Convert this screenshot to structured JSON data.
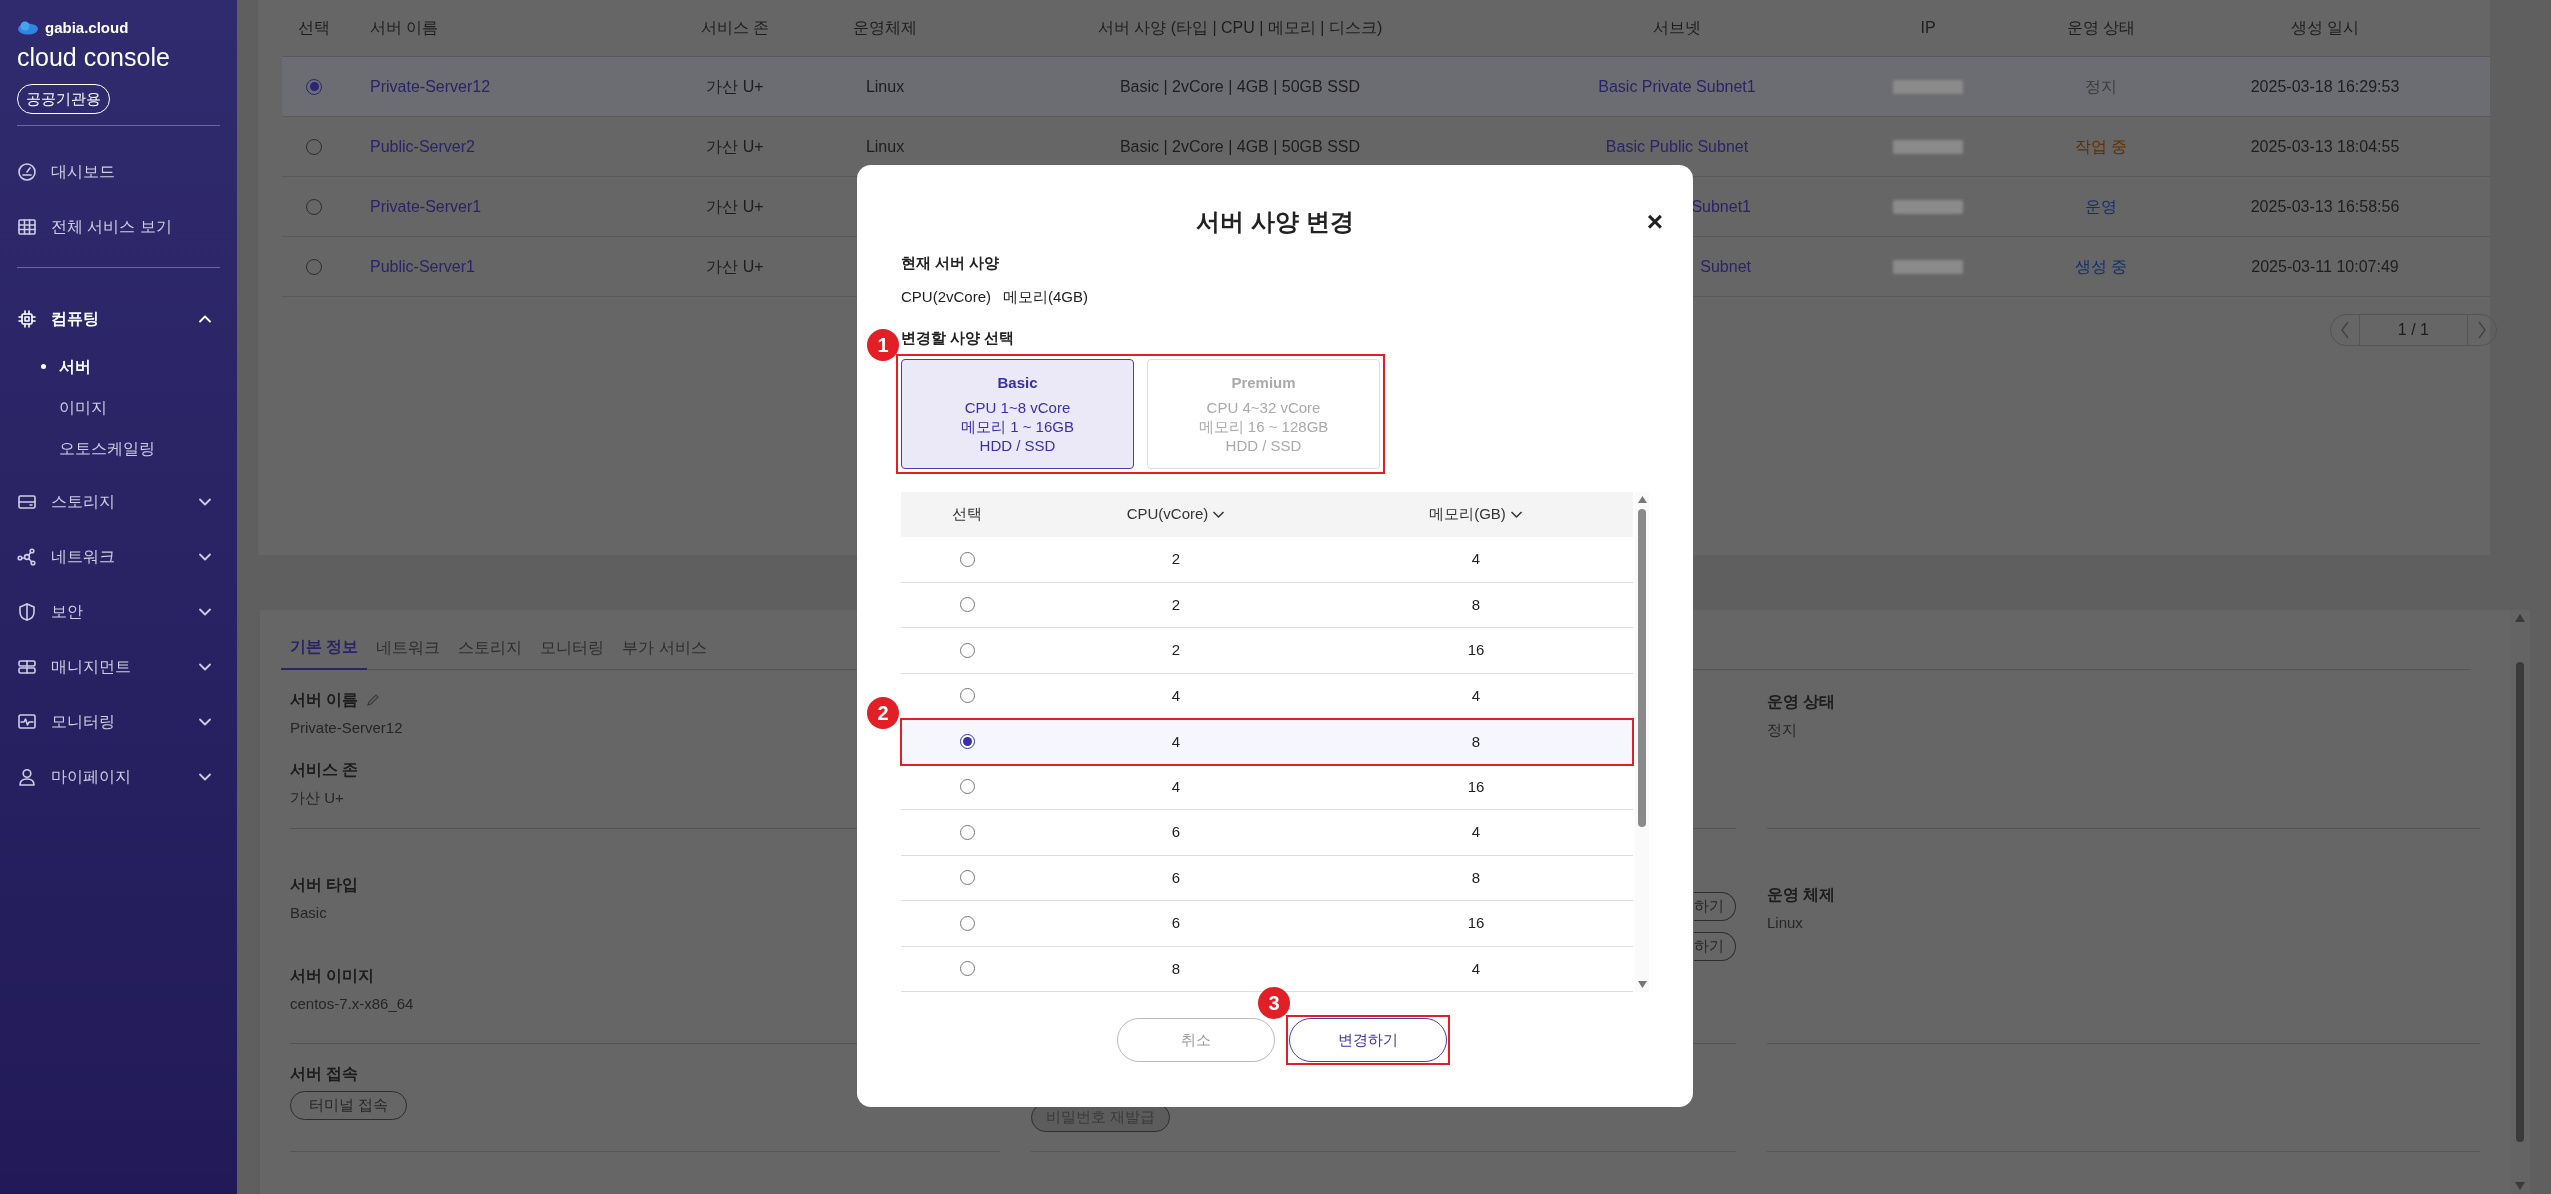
{
  "sidebar": {
    "brand": "gabia.cloud",
    "product": "**cloud** console",
    "badge": "공공기관용",
    "menu": [
      {
        "label": "대시보드"
      },
      {
        "label": "전체 서비스 보기"
      }
    ],
    "groups": [
      {
        "label": "컴퓨팅",
        "expanded": true,
        "children": [
          {
            "label": "서버",
            "selected": true
          },
          {
            "label": "이미지",
            "selected": false
          },
          {
            "label": "오토스케일링",
            "selected": false
          }
        ]
      },
      {
        "label": "스토리지",
        "expanded": false
      },
      {
        "label": "네트워크",
        "expanded": false
      },
      {
        "label": "보안",
        "expanded": false
      },
      {
        "label": "매니지먼트",
        "expanded": false
      },
      {
        "label": "모니터링",
        "expanded": false
      },
      {
        "label": "마이페이지",
        "expanded": false
      }
    ]
  },
  "server_table": {
    "columns": [
      "선택",
      "서버 이름",
      "서비스 존",
      "운영체제",
      "서버 사양 (타입 | CPU | 메모리 | 디스크)",
      "서브넷",
      "IP",
      "운영 상태",
      "생성 일시"
    ],
    "rows": [
      {
        "selected": true,
        "name": "Private-Server12",
        "zone": "가산 U+",
        "os": "Linux",
        "spec": "Basic | 2vCore | 4GB | 50GB SSD",
        "subnet": "Basic Private Subnet1",
        "status": "정지",
        "color": "#3d3d3d",
        "created": "2025-03-18 16:29:53"
      },
      {
        "selected": false,
        "name": "Public-Server2",
        "zone": "가산 U+",
        "os": "Linux",
        "spec": "Basic | 2vCore | 4GB | 50GB SSD",
        "subnet": "Basic Public Subnet",
        "status": "작업 중",
        "color": "#5e3100",
        "created": "2025-03-13 18:04:55"
      },
      {
        "selected": false,
        "name": "Private-Server1",
        "zone": "가산 U+",
        "subnet": "Subnet1",
        "subnet_cut": true,
        "status": "운영",
        "color": "#142f6e",
        "created": "2025-03-13 16:58:56"
      },
      {
        "selected": false,
        "name": "Public-Server1",
        "zone": "가산 U+",
        "subnet": "Subnet",
        "subnet_cut": true,
        "status": "생성 중",
        "color": "#142f6e",
        "created": "2025-03-11 10:07:49"
      }
    ],
    "pagination": "1 / 1"
  },
  "detail_panel": {
    "tabs": [
      {
        "label": "기본 정보",
        "selected": true
      },
      {
        "label": "네트워크",
        "selected": false
      },
      {
        "label": "스토리지",
        "selected": false
      },
      {
        "label": "모니터링",
        "selected": false
      },
      {
        "label": "부가 서비스",
        "selected": false
      }
    ],
    "left_fields": [
      {
        "label": "서버 이름",
        "value": "Private-Server12"
      },
      {
        "label": "서비스 존",
        "value": "가산 U+"
      },
      {
        "label": "서버 타입",
        "value": "Basic"
      },
      {
        "label": "서버 이미지",
        "value": "centos-7.x-x86_64"
      },
      {
        "label": "서버 접속",
        "button": "터미널 접속"
      }
    ],
    "middle_buttons": [
      "하기",
      "하기"
    ],
    "password_button": "비밀번호 재발급",
    "right_fields": [
      {
        "label": "운영 상태",
        "value": "정지"
      },
      {
        "label": "운영 체제",
        "value": "Linux"
      }
    ]
  },
  "modal": {
    "title": "서버 사양 변경",
    "close": "×",
    "current_label": "현재 서버 사양",
    "current_values": [
      "CPU(2vCore)",
      "메모리(4GB)"
    ],
    "choose_label": "변경할 사양 선택",
    "plans": [
      {
        "name": "Basic",
        "lines": [
          "CPU 1~8 vCore",
          "메모리 1 ~ 16GB",
          "HDD / SSD"
        ],
        "selected": true
      },
      {
        "name": "Premium",
        "lines": [
          "CPU 4~32 vCore",
          "메모리 16 ~ 128GB",
          "HDD / SSD"
        ],
        "selected": false
      }
    ],
    "columns": [
      "선택",
      "CPU(vCore)",
      "메모리(GB)"
    ],
    "rows": [
      {
        "cpu": "2",
        "memory": "4",
        "selected": false
      },
      {
        "cpu": "2",
        "memory": "8",
        "selected": false
      },
      {
        "cpu": "2",
        "memory": "16",
        "selected": false
      },
      {
        "cpu": "4",
        "memory": "4",
        "selected": false
      },
      {
        "cpu": "4",
        "memory": "8",
        "selected": true
      },
      {
        "cpu": "4",
        "memory": "16",
        "selected": false
      },
      {
        "cpu": "6",
        "memory": "4",
        "selected": false
      },
      {
        "cpu": "6",
        "memory": "8",
        "selected": false
      },
      {
        "cpu": "6",
        "memory": "16",
        "selected": false
      },
      {
        "cpu": "8",
        "memory": "4",
        "selected": false
      }
    ],
    "buttons": {
      "cancel": "취소",
      "confirm": "변경하기"
    },
    "annotations": [
      "1",
      "2",
      "3"
    ]
  }
}
